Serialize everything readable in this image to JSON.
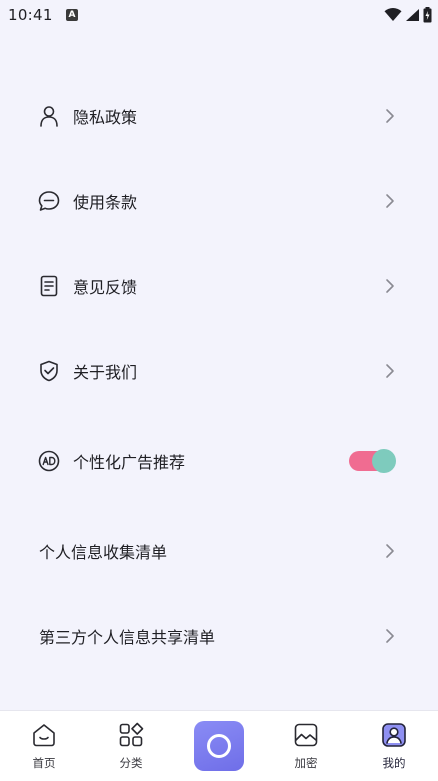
{
  "status_bar": {
    "time": "10:41",
    "notification_badge": "A",
    "icons": [
      "wifi-icon",
      "signal-icon",
      "battery-icon"
    ]
  },
  "menu": {
    "privacy_policy": "隐私政策",
    "terms_of_use": "使用条款",
    "feedback": "意见反馈",
    "about_us": "关于我们",
    "personalized_ads": "个性化广告推荐",
    "personalized_ads_enabled": true,
    "personal_info_list": "个人信息收集清单",
    "third_party_info_list": "第三方个人信息共享清单"
  },
  "tabbar": {
    "home": "首页",
    "category": "分类",
    "encrypt": "加密",
    "mine": "我的",
    "active_tab": "我的"
  },
  "colors": {
    "background": "#f3f3fc",
    "toggle_track": "#f06c91",
    "toggle_knob": "#7ecbbd",
    "center_button": "#7b7cef"
  }
}
